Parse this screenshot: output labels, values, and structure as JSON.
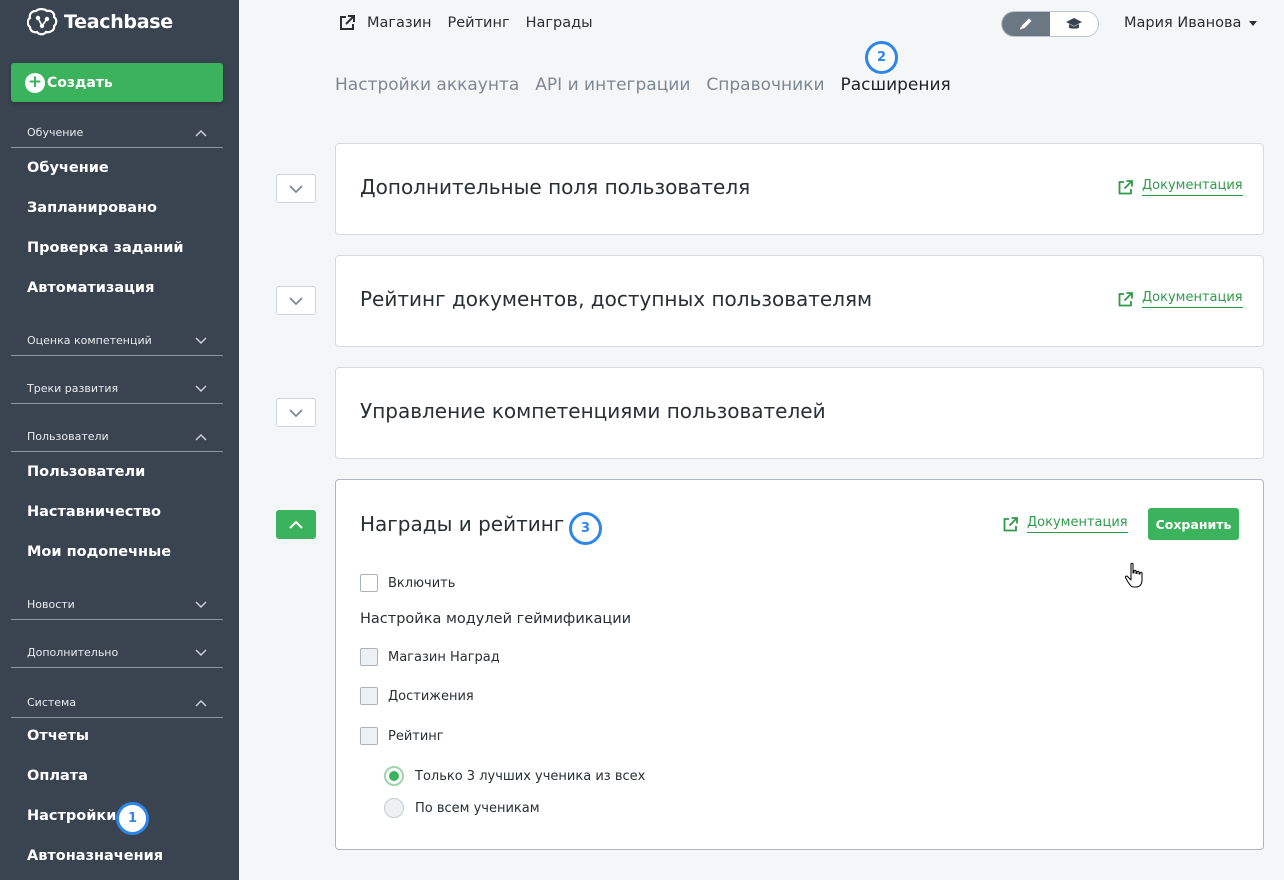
{
  "app": {
    "brand": "Teachbase",
    "create_label": "Создать"
  },
  "sidebar": {
    "sections": [
      {
        "label": "Обучение",
        "expanded": true,
        "items": [
          "Обучение",
          "Запланировано",
          "Проверка заданий",
          "Автоматизация"
        ]
      },
      {
        "label": "Оценка компетенций",
        "expanded": false,
        "items": []
      },
      {
        "label": "Треки развития",
        "expanded": false,
        "items": []
      },
      {
        "label": "Пользователи",
        "expanded": true,
        "items": [
          "Пользователи",
          "Наставничество",
          "Мои подопечные"
        ]
      },
      {
        "label": "Новости",
        "expanded": false,
        "items": []
      },
      {
        "label": "Дополнительно",
        "expanded": false,
        "items": []
      },
      {
        "label": "Система",
        "expanded": true,
        "items": [
          "Отчеты",
          "Оплата",
          "Настройки",
          "Автоназначения"
        ]
      }
    ]
  },
  "topnav": {
    "links": [
      "Магазин",
      "Рейтинг",
      "Награды"
    ],
    "user_name": "Мария Иванова"
  },
  "tabs": [
    "Настройки аккаунта",
    "API и интеграции",
    "Справочники",
    "Расширения"
  ],
  "active_tab": "Расширения",
  "markers": [
    "1",
    "2",
    "3"
  ],
  "panels": [
    {
      "title": "Дополнительные поля пользователя",
      "doc_label": "Документация",
      "expanded": false
    },
    {
      "title": "Рейтинг документов, доступных пользователям",
      "doc_label": "Документация",
      "expanded": false
    },
    {
      "title": "Управление компетенциями пользователей",
      "expanded": false
    },
    {
      "title": "Награды и рейтинг",
      "doc_label": "Документация",
      "save_label": "Сохранить",
      "expanded": true,
      "enable_label": "Включить",
      "enable_checked": false,
      "modules_heading": "Настройка модулей геймификации",
      "modules": [
        {
          "label": "Магазин Наград",
          "checked": false
        },
        {
          "label": "Достижения",
          "checked": false
        },
        {
          "label": "Рейтинг",
          "checked": false
        }
      ],
      "rating_options": [
        {
          "label": "Только 3 лучших ученика из всех",
          "selected": true
        },
        {
          "label": "По всем ученикам",
          "selected": false
        }
      ]
    }
  ],
  "colors": {
    "sidebar_bg": "#3a4450",
    "accent_green": "#3bb35c",
    "marker_blue": "#2d86e8",
    "link_green": "#2f9a4b"
  }
}
